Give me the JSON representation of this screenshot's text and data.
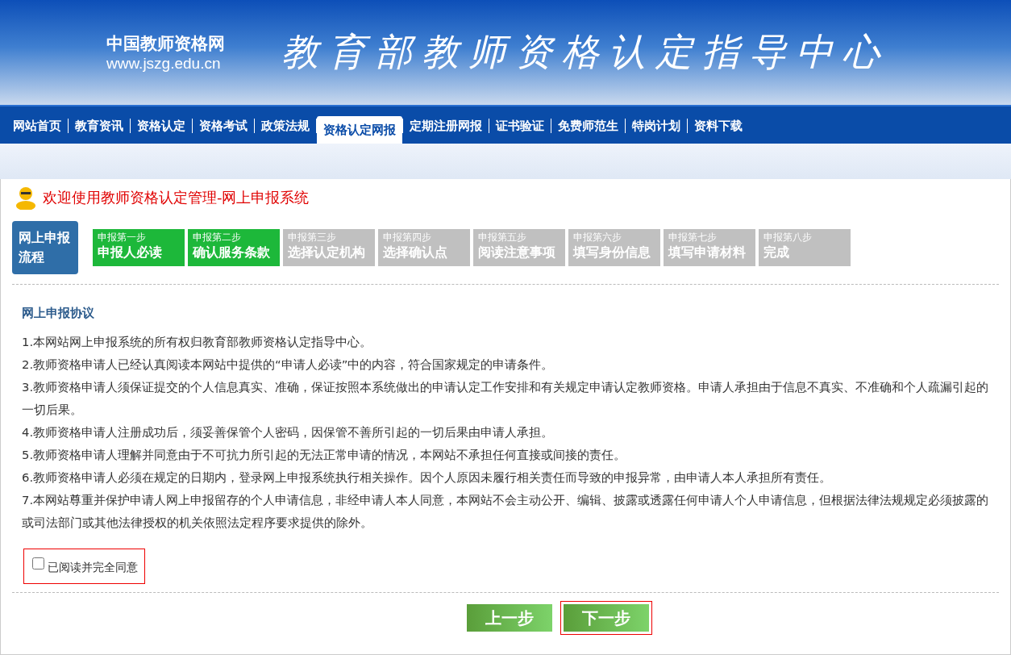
{
  "header": {
    "site_name": "中国教师资格网",
    "site_url": "www.jszg.edu.cn",
    "title": "教育部教师资格认定指导中心"
  },
  "nav": [
    {
      "label": "网站首页",
      "selected": false
    },
    {
      "label": "教育资讯",
      "selected": false
    },
    {
      "label": "资格认定",
      "selected": false
    },
    {
      "label": "资格考试",
      "selected": false
    },
    {
      "label": "政策法规",
      "selected": false
    },
    {
      "label": "资格认定网报",
      "selected": true
    },
    {
      "label": "定期注册网报",
      "selected": false
    },
    {
      "label": "证书验证",
      "selected": false
    },
    {
      "label": "免费师范生",
      "selected": false
    },
    {
      "label": "特岗计划",
      "selected": false
    },
    {
      "label": "资料下载",
      "selected": false
    }
  ],
  "welcome": "欢迎使用教师资格认定管理-网上申报系统",
  "flow_label": "网上申报流程",
  "steps": [
    {
      "step": "申报第一步",
      "name": "申报人必读",
      "done": true
    },
    {
      "step": "申报第二步",
      "name": "确认服务条款",
      "done": true
    },
    {
      "step": "申报第三步",
      "name": "选择认定机构",
      "done": false
    },
    {
      "step": "申报第四步",
      "name": "选择确认点",
      "done": false
    },
    {
      "step": "申报第五步",
      "name": "阅读注意事项",
      "done": false
    },
    {
      "step": "申报第六步",
      "name": "填写身份信息",
      "done": false
    },
    {
      "step": "申报第七步",
      "name": "填写申请材料",
      "done": false
    },
    {
      "step": "申报第八步",
      "name": "完成",
      "done": false
    }
  ],
  "agreement": {
    "title": "网上申报协议",
    "clauses": [
      "1.本网站网上申报系统的所有权归教育部教师资格认定指导中心。",
      "2.教师资格申请人已经认真阅读本网站中提供的“申请人必读”中的内容，符合国家规定的申请条件。",
      "3.教师资格申请人须保证提交的个人信息真实、准确，保证按照本系统做出的申请认定工作安排和有关规定申请认定教师资格。申请人承担由于信息不真实、不准确和个人疏漏引起的一切后果。",
      "4.教师资格申请人注册成功后，须妥善保管个人密码，因保管不善所引起的一切后果由申请人承担。",
      "5.教师资格申请人理解并同意由于不可抗力所引起的无法正常申请的情况，本网站不承担任何直接或间接的责任。",
      "6.教师资格申请人必须在规定的日期内，登录网上申报系统执行相关操作。因个人原因未履行相关责任而导致的申报异常，由申请人本人承担所有责任。",
      "7.本网站尊重并保护申请人网上申报留存的个人申请信息，非经申请人本人同意，本网站不会主动公开、编辑、披露或透露任何申请人个人申请信息，但根据法律法规规定必须披露的或司法部门或其他法律授权的机关依照法定程序要求提供的除外。"
    ]
  },
  "agree": {
    "label": "已阅读并完全同意",
    "checked": false,
    "highlighted": true
  },
  "buttons": [
    {
      "label": "上一步",
      "highlighted": false
    },
    {
      "label": "下一步",
      "highlighted": true
    }
  ]
}
